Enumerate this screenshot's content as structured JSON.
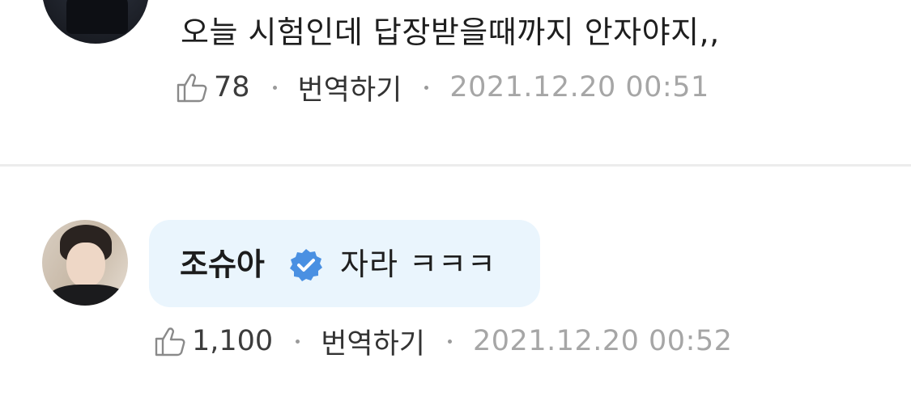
{
  "comments": [
    {
      "text": "오늘 시험인데 답장받을때까지 안자야지,,",
      "likes": "78",
      "translate_label": "번역하기",
      "timestamp": "2021.12.20 00:51"
    }
  ],
  "reply": {
    "author": "조슈아",
    "verified": true,
    "text": "자라 ㅋㅋㅋ",
    "likes": "1,100",
    "translate_label": "번역하기",
    "timestamp": "2021.12.20 00:52"
  },
  "icons": {
    "like": "thumbs-up-outline-icon",
    "verified": "verified-badge-icon"
  },
  "colors": {
    "bubble_background": "#eaf5fd",
    "verified_blue": "#4a90e2",
    "timestamp_gray": "#a6a6a6",
    "divider": "#ececec"
  }
}
